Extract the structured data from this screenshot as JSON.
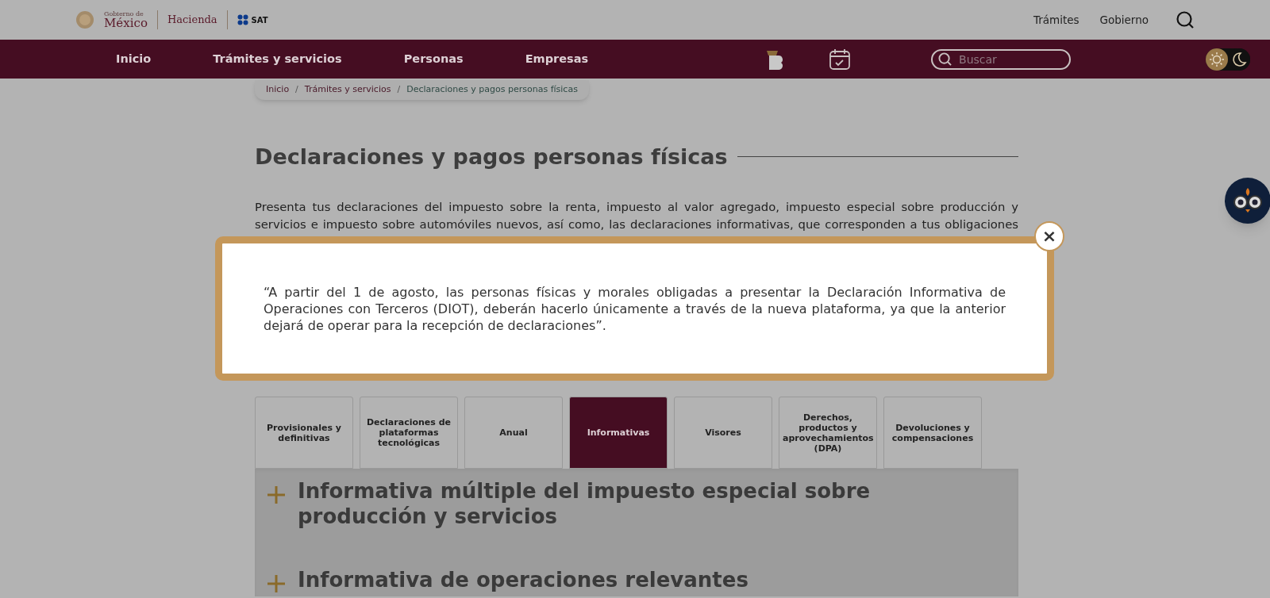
{
  "header": {
    "logo": {
      "gobierno": "Gobierno de",
      "mexico": "México",
      "hacienda": "Hacienda",
      "sat": "SAT"
    },
    "links": [
      "Trámites",
      "Gobierno"
    ]
  },
  "nav": {
    "items": [
      "Inicio",
      "Trámites y servicios",
      "Personas",
      "Empresas"
    ],
    "search": {
      "placeholder": "Buscar"
    },
    "theme_toggle": [
      {
        "kind": "sun",
        "selected": true
      },
      {
        "kind": "moon",
        "selected": false
      }
    ]
  },
  "breadcrumb_separator": "/",
  "breadcrumb": [
    "Inicio",
    "Trámites y servicios",
    "Declaraciones y pagos personas físicas"
  ],
  "title": "Declaraciones y pagos personas físicas",
  "intro": [
    "Presenta tus declaraciones del impuesto sobre la renta, impuesto al valor agregado, impuesto especial sobre producción y",
    "servicios e impuesto sobre automóviles nuevos, así como, las declaraciones informativas, que corresponden a tus obligaciones"
  ],
  "tabs": [
    {
      "label": "Provisionales y definitivas",
      "selected": false
    },
    {
      "label": "Declaraciones de plataformas tecnológicas",
      "selected": false
    },
    {
      "label": "Anual",
      "selected": false
    },
    {
      "label": "Informativas",
      "selected": true
    },
    {
      "label": "Visores",
      "selected": false
    },
    {
      "label": "Derechos, productos y aprovechamientos (DPA)",
      "selected": false
    },
    {
      "label": "Devoluciones y compensaciones",
      "selected": false
    }
  ],
  "accordion": [
    {
      "title": "Informativa múltiple del impuesto especial sobre producción y servicios",
      "expanded": false
    },
    {
      "title": "Informativa de operaciones relevantes",
      "expanded": false
    }
  ],
  "modal": {
    "close": "×",
    "text": "“A partir del 1 de agosto, las personas físicas y morales obligadas a presentar la Declaración Informativa de Operaciones con Terceros (DIOT), deberán hacerlo únicamente a través de la nueva plataforma, ya que la anterior dejará de operar para la recepción de declaraciones”."
  }
}
